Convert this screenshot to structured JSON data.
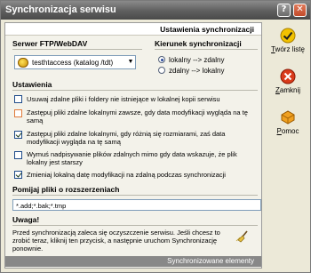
{
  "window": {
    "title": "Synchronizacja serwisu",
    "help_glyph": "?",
    "close_glyph": "✕"
  },
  "panel": {
    "header": "Ustawienia synchronizacji",
    "server": {
      "title": "Serwer FTP/WebDAV",
      "value": "testhtaccess (katalog /tdt)",
      "dropdown_glyph": "▼"
    },
    "direction": {
      "title": "Kierunek synchronizacji",
      "options": [
        {
          "label": "lokalny --> zdalny",
          "selected": true
        },
        {
          "label": "zdalny --> lokalny",
          "selected": false
        }
      ]
    },
    "settings": {
      "title": "Ustawienia",
      "items": [
        {
          "label": "Usuwaj zdalne pliki i foldery nie istniejące w lokalnej kopii serwisu",
          "checked": false
        },
        {
          "label": "Zastępuj pliki zdalne lokalnymi zawsze, gdy data modyfikacji wygląda na tę samą",
          "checked": false
        },
        {
          "label": "Zastępuj pliki zdalne lokalnymi, gdy różnią się rozmiarami, zaś data modyfikacji wygląda na tę samą",
          "checked": true
        },
        {
          "label": "Wymuś nadpisywanie plików zdalnych mimo gdy data wskazuje, że plik lokalny jest starszy",
          "checked": false
        },
        {
          "label": "Zmieniaj lokalną datę modyfikacji na zdalną podczas synchronizacji",
          "checked": true
        }
      ]
    },
    "extensions": {
      "title": "Pomijaj pliki o rozszerzeniach",
      "value": "*.add;*.bak;*.tmp"
    },
    "warning": {
      "title": "Uwaga!",
      "text": "Przed synchronizacją zaleca się oczyszczenie serwisu. Jeśli chcesz to zrobić teraz, kliknij ten przycisk, a następnie uruchom Synchronizację ponownie."
    },
    "footer": "Synchronizowane elementy"
  },
  "sidebar": {
    "create": {
      "label_pre": "",
      "label_ul": "T",
      "label_post": "wórz listę",
      "icon": "check-icon"
    },
    "close": {
      "label_pre": "",
      "label_ul": "Z",
      "label_post": "amknij",
      "icon": "close-icon"
    },
    "help": {
      "label_pre": "",
      "label_ul": "P",
      "label_post": "omoc",
      "icon": "help-icon"
    }
  },
  "colors": {
    "titlebar": "#5e5e5e",
    "highlight_checkbox": "#e07a3a"
  }
}
